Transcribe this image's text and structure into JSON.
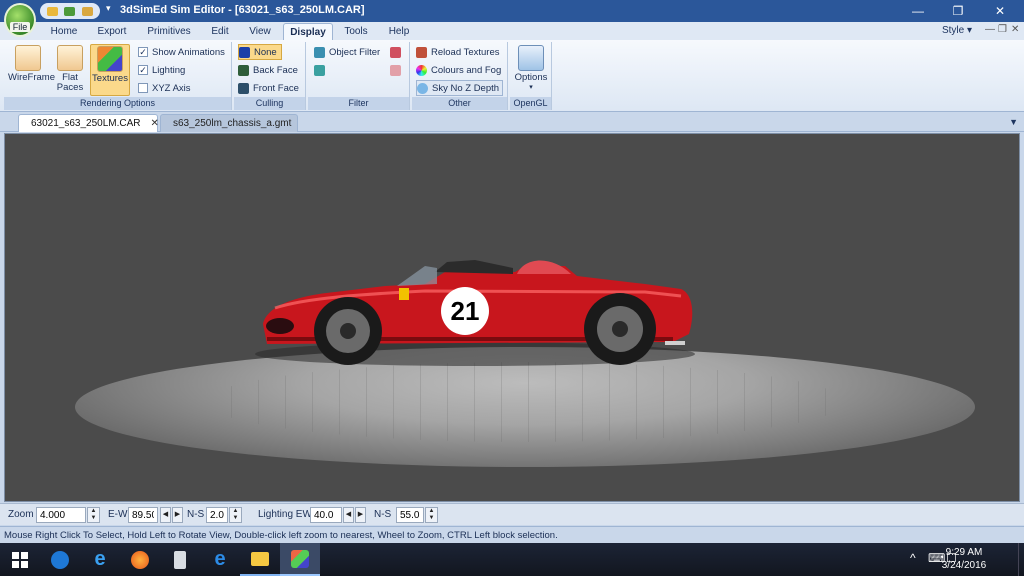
{
  "window": {
    "title": "3dSimEd Sim Editor - [63021_s63_250LM.CAR]",
    "file_button_label": "File",
    "controls": [
      "—",
      "❐",
      "✕"
    ]
  },
  "ribbon": {
    "tabs": [
      "Home",
      "Export",
      "Primitives",
      "Edit",
      "View",
      "Display",
      "Tools",
      "Help"
    ],
    "active_tab": "Display",
    "style_label": "Style",
    "groups": {
      "rendering_options": {
        "label": "Rendering Options",
        "wireframe": "WireFrame",
        "flat_paces": "Flat Paces",
        "textures": "Textures",
        "show_animations": "Show Animations",
        "lighting": "Lighting",
        "xyz_axis": "XYZ Axis"
      },
      "culling": {
        "label": "Culling",
        "none": "None",
        "back_face": "Back Face",
        "front_face": "Front Face"
      },
      "filter": {
        "label": "Filter",
        "object_filter": "Object Filter"
      },
      "other": {
        "label": "Other",
        "reload_textures": "Reload Textures",
        "colours_and_fog": "Colours and Fog",
        "sky_no_z_depth": "Sky No Z Depth"
      },
      "opengl": {
        "label": "OpenGL",
        "options": "Options"
      }
    }
  },
  "document_tabs": [
    {
      "label": "63021_s63_250LM.CAR",
      "active": true
    },
    {
      "label": "s63_250lm_chassis_a.gmt",
      "active": false
    }
  ],
  "viewport": {
    "car_number": "21",
    "car_color": "#c8161d"
  },
  "navbar": {
    "zoom_label": "Zoom",
    "zoom_value": "4.000",
    "ew_label": "E-W",
    "ew_value": "89.50",
    "ns_label": "N-S",
    "ns_value": "2.0",
    "lighting_ew_label": "Lighting EW",
    "lighting_ew_value": "40.0",
    "lighting_ns_label": "N-S",
    "lighting_ns_value": "55.0"
  },
  "statusbar": {
    "text": "Mouse Right Click To Select, Hold Left to Rotate View, Double-click left  zoom to nearest, Wheel to Zoom, CTRL Left block selection."
  },
  "taskbar": {
    "time": "9:29 AM",
    "date": "3/24/2016",
    "tray_icons": [
      "^",
      "⌨",
      "☐"
    ]
  }
}
